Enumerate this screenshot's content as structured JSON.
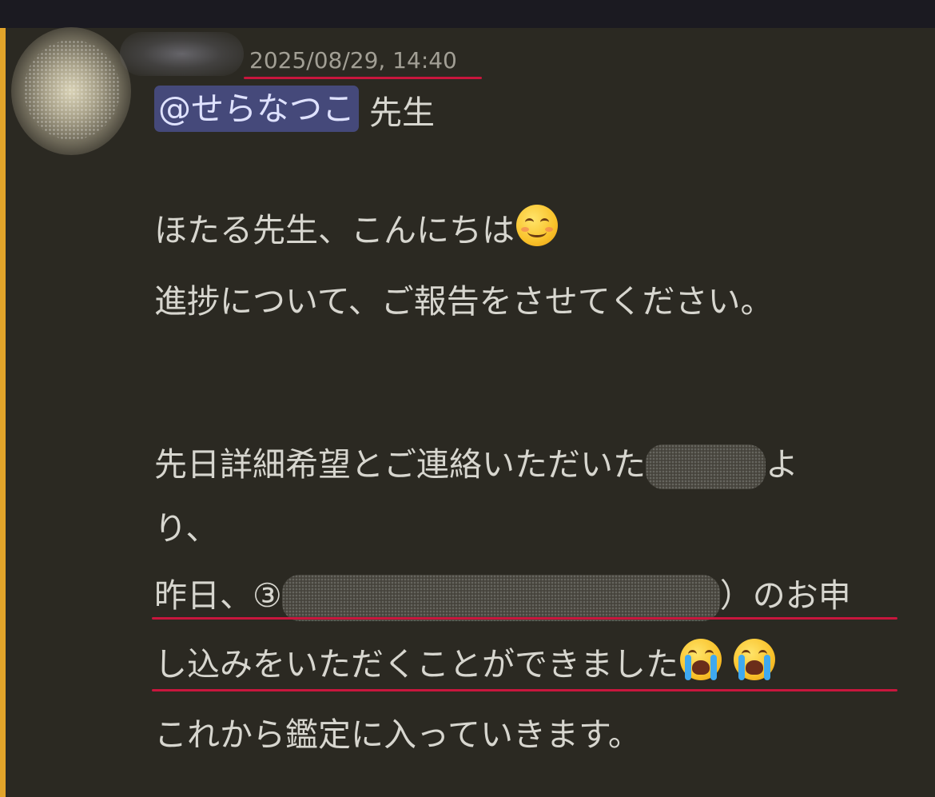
{
  "message": {
    "timestamp": "2025/08/29, 14:40",
    "mention": "@せらなつこ",
    "mention_suffix": " 先生",
    "greeting": "ほたる先生、こんにちは",
    "greeting_emoji": "smiling-face-icon",
    "line_report": "進捗について、ご報告をさせてください。",
    "line_contact_prefix": "先日詳細希望とご連絡いただいた",
    "line_contact_suffix": "よ",
    "line_contact_wrap": "り、",
    "line_application_prefix": "昨日、③",
    "line_application_suffix": "）のお申",
    "line_application_wrap": "し込みをいただくことができました",
    "line_application_emojis": [
      "crying-face-icon",
      "crying-face-icon"
    ],
    "line_closing": "これから鑑定に入っていきます。"
  },
  "colors": {
    "background": "#2b2922",
    "top_bar": "#1b1a21",
    "mention_highlight_bar": "#e2a42a",
    "mention_chip": "#45497a",
    "annotation_underline": "#c8163d",
    "timestamp": "#a29f95"
  }
}
